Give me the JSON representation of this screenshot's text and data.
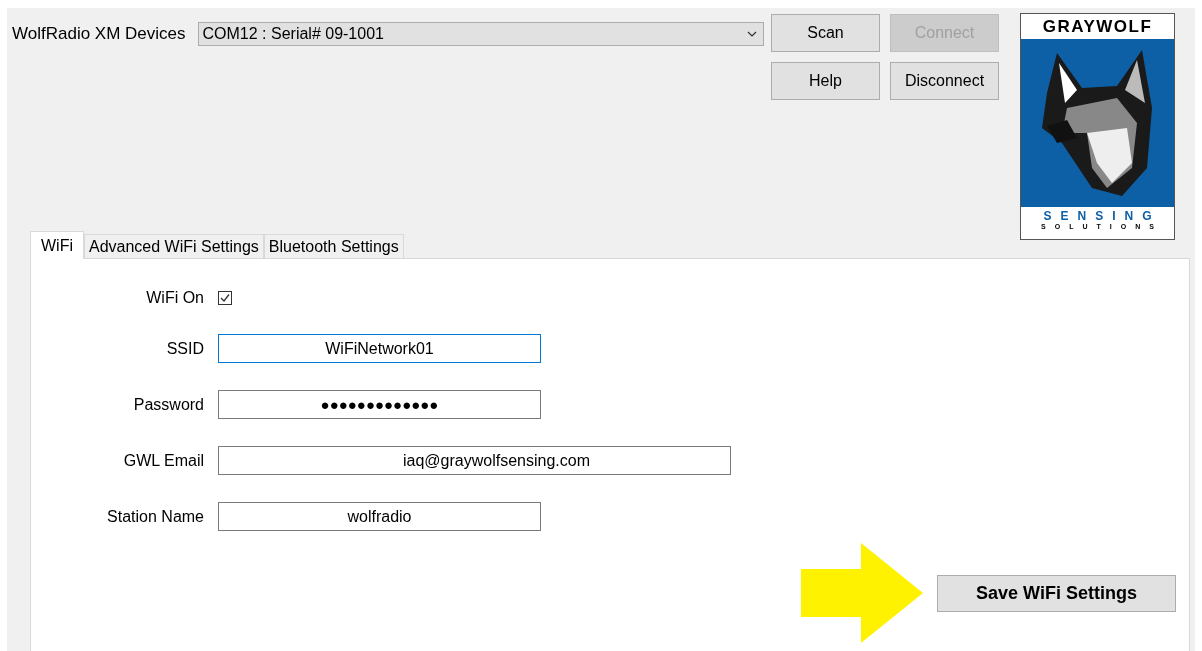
{
  "device_bar": {
    "label": "WolfRadio XM Devices",
    "device": "COM12 : Serial# 09-1001"
  },
  "buttons": [
    {
      "label": "Scan",
      "disabled": false
    },
    {
      "label": "Connect",
      "disabled": true
    },
    {
      "label": "Help",
      "disabled": false
    },
    {
      "label": "Disconnect",
      "disabled": false
    }
  ],
  "logo": {
    "brand": "GRAYWOLF",
    "line_1": "SENSING",
    "line_2": "SOLUTIONS"
  },
  "tabs": [
    {
      "label": "WiFi",
      "selected": true
    },
    {
      "label": "Advanced WiFi Settings",
      "selected": false
    },
    {
      "label": "Bluetooth Settings",
      "selected": false
    }
  ],
  "fields": [
    {
      "kind": "checkbox",
      "label": "WiFi On",
      "checked": true
    },
    {
      "kind": "text",
      "label": "SSID",
      "value": "WiFiNetwork01",
      "focused": true,
      "wide": false
    },
    {
      "kind": "password",
      "label": "Password",
      "value": "●●●●●●●●●●●●●",
      "focused": false,
      "wide": false
    },
    {
      "kind": "text",
      "label": "GWL Email",
      "value": "iaq@graywolfsensing.com",
      "focused": false,
      "wide": true
    },
    {
      "kind": "text",
      "label": "Station Name",
      "value": "wolfradio",
      "focused": false,
      "wide": false
    }
  ],
  "save_button": "Save WiFi Settings"
}
